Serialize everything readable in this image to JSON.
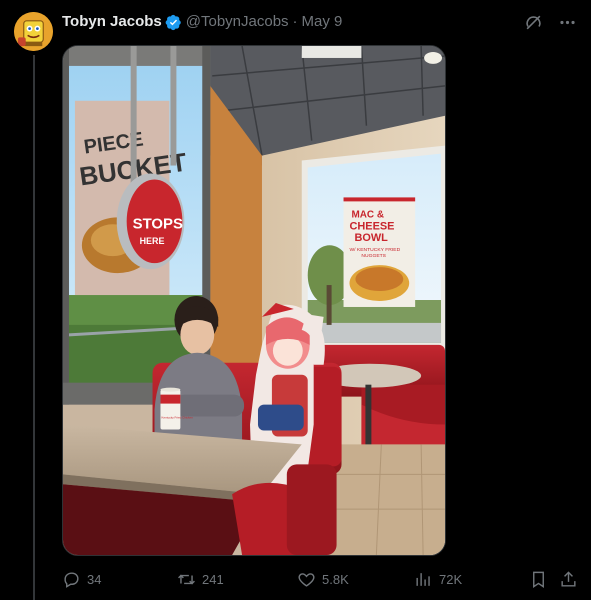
{
  "tweet": {
    "author_name": "Tobyn Jacobs",
    "handle": "@TobynJacobs",
    "separator": "·",
    "date": "May 9",
    "verified": true
  },
  "actions": {
    "reply_count": "34",
    "retweet_count": "241",
    "like_count": "5.8K",
    "view_count": "72K"
  },
  "photo": {
    "sign_line1": "MAC &",
    "sign_line2": "CHEESE",
    "sign_line3": "BOWL",
    "sign_sub": "W/ KENTUCKY FRIED",
    "sign_sub2": "NUGGETS",
    "stops_text": "STOPS",
    "stops_sub": "HERE",
    "window_text_1": "PIECE",
    "window_text_2": "BUCKET",
    "cup_text": "Kentucky Fried Chicken"
  },
  "colors": {
    "background": "#000000",
    "text_primary": "#e7e9ea",
    "text_secondary": "#71767b",
    "verified": "#1d9bf0",
    "booth_red": "#b51d26"
  },
  "icons": {
    "verified": "verified-badge-icon",
    "grok": "grok-icon",
    "more": "more-icon",
    "reply": "reply-icon",
    "retweet": "retweet-icon",
    "like": "heart-icon",
    "views": "views-icon",
    "bookmark": "bookmark-icon",
    "share": "share-icon"
  }
}
